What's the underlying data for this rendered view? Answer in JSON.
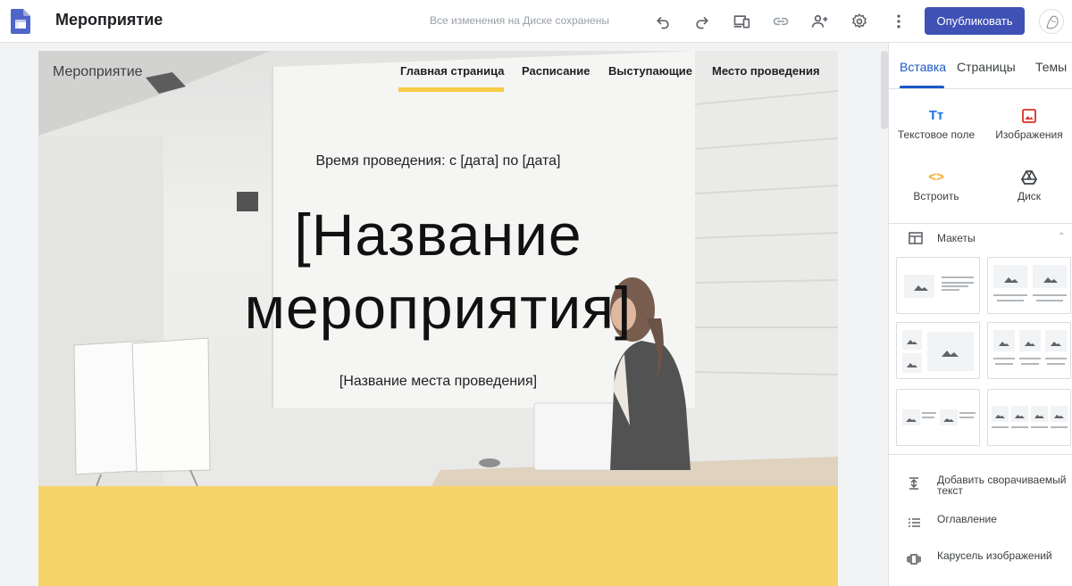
{
  "app": {
    "site_title": "Мероприятие",
    "save_status": "Все изменения на Диске сохранены",
    "publish_label": "Опубликовать",
    "toolbar_icons": [
      "undo-icon",
      "redo-icon",
      "preview-icon",
      "link-icon",
      "share-icon",
      "settings-icon",
      "more-icon"
    ]
  },
  "hero": {
    "brand": "Мероприятие",
    "nav": [
      "Главная страница",
      "Расписание",
      "Выступающие",
      "Место проведения"
    ],
    "date_line": "Время проведения: с [дата] по [дата]",
    "title_line1": "[Название",
    "title_line2": "мероприятия]",
    "venue": "[Название места проведения]",
    "accent_color": "#f7cd47"
  },
  "panel": {
    "tabs": [
      "Вставка",
      "Страницы",
      "Темы"
    ],
    "insert_items": [
      {
        "label": "Текстовое поле",
        "icon": "text-box-icon",
        "glyph": "Tт"
      },
      {
        "label": "Изображения",
        "icon": "image-icon"
      },
      {
        "label": "Встроить",
        "icon": "embed-icon",
        "glyph": "<>"
      },
      {
        "label": "Диск",
        "icon": "drive-icon"
      }
    ],
    "layouts_label": "Макеты",
    "actions": [
      {
        "label": "Добавить сворачиваемый текст",
        "icon": "collapsible-text-icon"
      },
      {
        "label": "Оглавление",
        "icon": "table-of-contents-icon"
      },
      {
        "label": "Карусель изображений",
        "icon": "image-carousel-icon"
      }
    ]
  }
}
